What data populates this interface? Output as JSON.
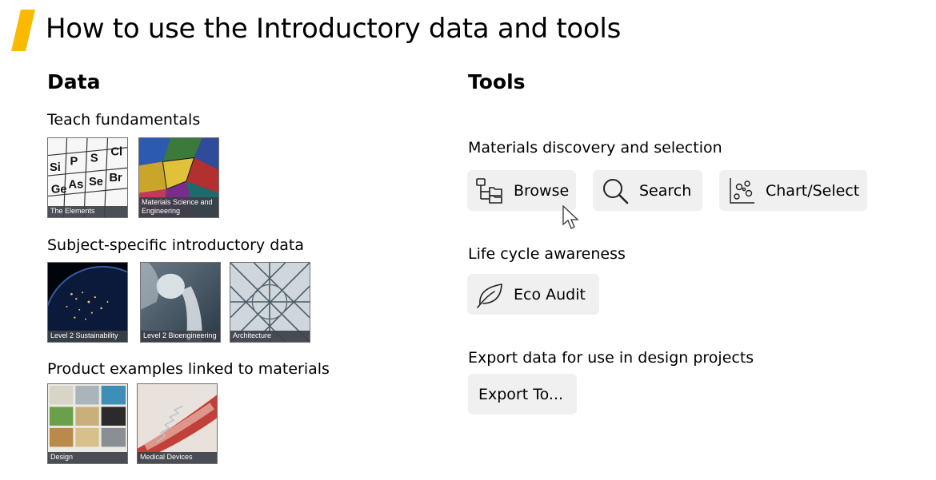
{
  "page_title": "How to use the Introductory data and tools",
  "colors": {
    "accent": "#fbb900",
    "button_bg": "#f0f0f0",
    "caption_bg": "#3c4048"
  },
  "data_section": {
    "title": "Data",
    "groups": [
      {
        "heading": "Teach fundamentals",
        "items": [
          {
            "caption": "The Elements",
            "icon": "periodic-table-image"
          },
          {
            "caption": "Materials Science and Engineering",
            "icon": "microstructure-image"
          }
        ]
      },
      {
        "heading": "Subject-specific introductory data",
        "items": [
          {
            "caption": "Level 2 Sustainability",
            "icon": "earth-night-image"
          },
          {
            "caption": "Level 2 Bioengineering",
            "icon": "hip-joint-xray-image"
          },
          {
            "caption": "Architecture",
            "icon": "glass-roof-image"
          }
        ]
      },
      {
        "heading": "Product examples linked to materials",
        "items": [
          {
            "caption": "Design",
            "icon": "product-collage-image"
          },
          {
            "caption": "Medical Devices",
            "icon": "stent-artery-image"
          }
        ]
      }
    ],
    "pt_symbols": [
      "Si",
      "P",
      "S",
      "Cl",
      "Ge",
      "As",
      "Se",
      "Br"
    ]
  },
  "tools_section": {
    "title": "Tools",
    "discovery": {
      "heading": "Materials discovery and selection",
      "buttons": [
        {
          "label": "Browse",
          "icon": "tree-browse-icon"
        },
        {
          "label": "Search",
          "icon": "magnifier-icon"
        },
        {
          "label": "Chart/Select",
          "icon": "bubble-chart-icon"
        }
      ]
    },
    "lifecycle": {
      "heading": "Life cycle awareness",
      "buttons": [
        {
          "label": "Eco Audit",
          "icon": "leaf-icon"
        }
      ]
    },
    "export": {
      "heading": "Export data for use in design projects",
      "buttons": [
        {
          "label": "Export To...",
          "icon": ""
        }
      ]
    }
  }
}
